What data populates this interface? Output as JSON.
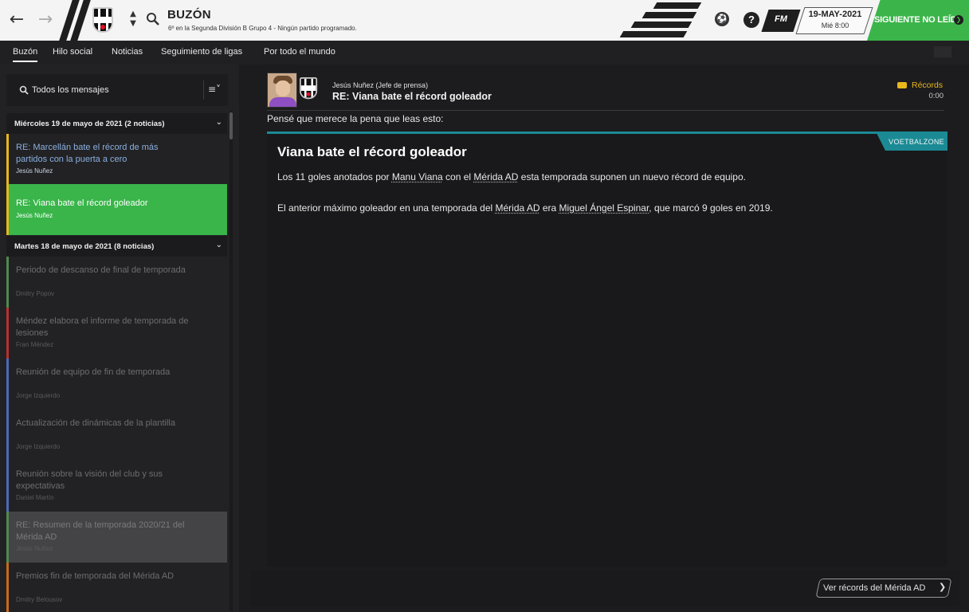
{
  "topbar": {
    "back_icon": "arrow-left",
    "forward_icon": "arrow-right",
    "title": "BUZÓN",
    "subtitle": "6º en la Segunda División B Grupo 4 - Ningún partido programado.",
    "fm_logo": "FM",
    "date": "19-MAY-2021",
    "day_time": "Mié 8:00",
    "next_button": "SIGUIENTE NO LEÍDO",
    "accent_green": "#3bb54a"
  },
  "tabs": [
    "Buzón",
    "Hilo social",
    "Noticias",
    "Seguimiento de ligas",
    "Por todo el mundo"
  ],
  "sidebar": {
    "filter_label": "Todos los mensajes",
    "groups": [
      {
        "header": "Miércoles 19 de mayo de 2021 (2 noticias)",
        "messages": [
          {
            "title": "RE: Marcellán bate el récord de más partidos con la puerta a cero",
            "from": "Jesús Nuñez",
            "state": "unread",
            "color": "#e8b71c"
          },
          {
            "title": "RE: Viana bate el récord goleador",
            "from": "Jesús Nuñez",
            "state": "selected",
            "color": "#e8b71c"
          }
        ]
      },
      {
        "header": "Martes 18 de mayo de 2021 (8 noticias)",
        "messages": [
          {
            "title": "Periodo de descanso de final de temporada",
            "from": "Dmitry Popov",
            "state": "read",
            "color": "#4f8a4f"
          },
          {
            "title": "Méndez elabora el informe de temporada de lesiones",
            "from": "Fran Méndez",
            "state": "read",
            "color": "#b83030"
          },
          {
            "title": "Reunión de equipo de fin de temporada",
            "from": "Jorge Izquierdo",
            "state": "read",
            "color": "#4a6ab8"
          },
          {
            "title": "Actualización de dinámicas de la plantilla",
            "from": "Jorge Izquierdo",
            "state": "read",
            "color": "#4a6ab8"
          },
          {
            "title": "Reunión sobre la visión del club y sus expectativas",
            "from": "Daniel Martín",
            "state": "read",
            "color": "#4a6ab8"
          },
          {
            "title": "RE: Resumen de la temporada 2020/21 del Mérida AD",
            "from": "Jesús Nuñez",
            "state": "hover",
            "color": "#4f8a4f"
          },
          {
            "title": "Premios fin de temporada del Mérida AD",
            "from": "Dmitry Belousov",
            "state": "read",
            "color": "#c86a1a"
          }
        ]
      }
    ]
  },
  "message": {
    "sender": "Jesús Nuñez  (Jefe de prensa)",
    "subject": "RE: Viana bate el récord goleador",
    "tag": "Récords",
    "tag_color": "#e8b71c",
    "time": "0:00",
    "intro": "Pensé que merece la pena que leas esto:",
    "source": "VOETBALZONE",
    "source_color": "#1b8a94",
    "article_title": "Viana bate el récord goleador",
    "p1": {
      "a": "Los 11 goles anotados por ",
      "b": "Manu Viana",
      "c": " con el ",
      "d": "Mérida AD",
      "e": " esta temporada suponen un nuevo récord de equipo."
    },
    "p2": {
      "a": "El anterior máximo goleador en una temporada del ",
      "b": "Mérida AD",
      "c": " era ",
      "d": "Miguel Ángel Espinar",
      "e": ", que marcó 9 goles en 2019."
    },
    "records_button": "Ver récords del Mérida AD"
  }
}
